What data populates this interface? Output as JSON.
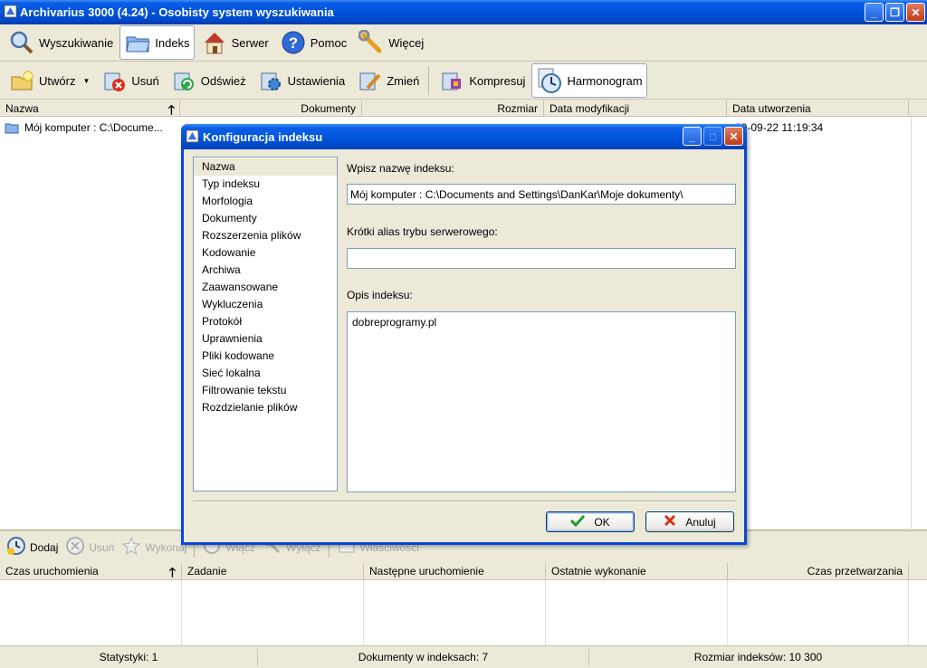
{
  "window": {
    "title": "Archivarius 3000 (4.24) - Osobisty system wyszukiwania"
  },
  "main_tabs": [
    {
      "label": "Wyszukiwanie",
      "icon": "magnifier-icon",
      "active": false
    },
    {
      "label": "Indeks",
      "icon": "folder-icon",
      "active": true
    },
    {
      "label": "Serwer",
      "icon": "house-icon",
      "active": false
    },
    {
      "label": "Pomoc",
      "icon": "help-icon",
      "active": false
    },
    {
      "label": "Więcej",
      "icon": "wrench-icon",
      "active": false
    }
  ],
  "actions": [
    {
      "label": "Utwórz",
      "icon": "create-index-icon",
      "dropdown": true
    },
    {
      "label": "Usuń",
      "icon": "delete-index-icon"
    },
    {
      "label": "Odśwież",
      "icon": "refresh-index-icon"
    },
    {
      "label": "Ustawienia",
      "icon": "settings-index-icon"
    },
    {
      "label": "Zmień",
      "icon": "edit-index-icon"
    },
    {
      "label": "Kompresuj",
      "icon": "compress-index-icon"
    },
    {
      "label": "Harmonogram",
      "icon": "clock-icon",
      "active": true
    }
  ],
  "index_list": {
    "columns": [
      "Nazwa",
      "Dokumenty",
      "Rozmiar",
      "Data modyfikacji",
      "Data utworzenia"
    ],
    "rows": [
      {
        "name": "Mój komputer : C:\\Docume...",
        "created": "09-09-22 11:19:34"
      }
    ]
  },
  "schedule_toolbar": [
    {
      "label": "Dodaj",
      "icon": "add-task-icon",
      "enabled": true
    },
    {
      "label": "Usuń",
      "icon": "remove-task-icon",
      "enabled": false
    },
    {
      "label": "Wykonaj",
      "icon": "run-task-icon",
      "enabled": false
    },
    {
      "label": "Włącz",
      "icon": "enable-task-icon",
      "enabled": false
    },
    {
      "label": "Wyłącz",
      "icon": "disable-task-icon",
      "enabled": false
    },
    {
      "label": "Właściwości",
      "icon": "properties-icon",
      "enabled": false
    }
  ],
  "schedule_columns": [
    "Czas uruchomienia",
    "Zadanie",
    "Następne uruchomienie",
    "Ostatnie wykonanie",
    "Czas przetwarzania"
  ],
  "status": {
    "stats": "Statystyki: 1",
    "docs": "Dokumenty w indeksach: 7",
    "size": "Rozmiar indeksów: 10 300"
  },
  "dialog": {
    "title": "Konfiguracja indeksu",
    "nav": [
      "Nazwa",
      "Typ indeksu",
      "Morfologia",
      "Dokumenty",
      "Rozszerzenia plików",
      "Kodowanie",
      "Archiwa",
      "Zaawansowane",
      "Wykluczenia",
      "Protokół",
      "Uprawnienia",
      "Pliki kodowane",
      "Sieć lokalna",
      "Filtrowanie tekstu",
      "Rozdzielanie plików"
    ],
    "selected_nav": "Nazwa",
    "name_label": "Wpisz nazwę indeksu:",
    "name_value": "Mój komputer : C:\\Documents and Settings\\DanKar\\Moje dokumenty\\",
    "alias_label": "Krótki alias trybu serwerowego:",
    "alias_value": "",
    "desc_label": "Opis indeksu:",
    "desc_value": "dobreprogramy.pl",
    "ok": "OK",
    "cancel": "Anuluj"
  },
  "colors": {
    "titlebar": "#0054da",
    "face": "#ece9d8",
    "ok_check": "#2a9a2a",
    "cancel_x": "#d6301a"
  }
}
